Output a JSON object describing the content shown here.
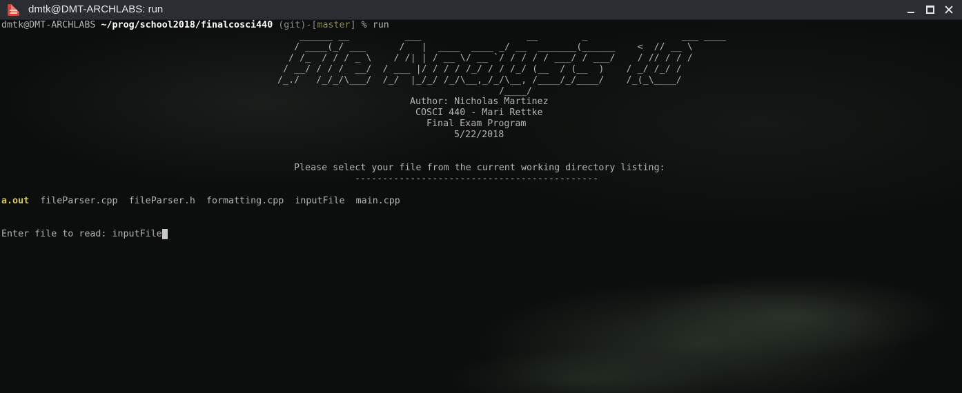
{
  "window": {
    "title": "dmtk@DMT-ARCHLABS: run"
  },
  "prompt": {
    "user": "dmtk",
    "at": "@",
    "host": "DMT-ARCHLABS",
    "path": "~/prog/school2018/finalcosci440",
    "git_open": "(git)-[",
    "branch": "master",
    "git_close": "]",
    "symbol": "% ",
    "command": "run"
  },
  "banner": {
    "ascii": [
      "    ______ __          ___                   __        _                 ___ ____",
      "   / ____(_/ ___      /   |  ____  ____ _/ __  _______(______    <  // __ \\",
      "  / /_  / / / _ \\    / /| | / __ \\/ __ `/ / / / / ___/ / ___/    / // / / /",
      " / __/ / / /  __/  / ___ |/ / / / /_/ / / /_/ (__  / (__  )    / _/ /_/ /",
      "/_./   /_/_/\\___/  /_/  |_/_/ /_/\\__,_/_/\\__, /____/_/____/    /_(_\\____/",
      "                                        /____/"
    ],
    "author": "Author: Nicholas Martinez",
    "course": "COSCI 440 - Mari Rettke",
    "program": "Final Exam Program",
    "date": "5/22/2018"
  },
  "instruction": "Please select your file from the current working directory listing:",
  "separator": "--------------------------------------------",
  "files": [
    "a.out",
    "fileParser.cpp",
    "fileParser.h",
    "formatting.cpp",
    "inputFile",
    "main.cpp"
  ],
  "input": {
    "label": "Enter file to read: ",
    "value": "inputFile"
  },
  "colors": {
    "text": "#b3b3b3",
    "path": "#ffffff",
    "branch": "#8e8b4a",
    "executable": "#d5c85a",
    "titlebar": "#2a2e32",
    "app_icon": "#d8403a"
  }
}
